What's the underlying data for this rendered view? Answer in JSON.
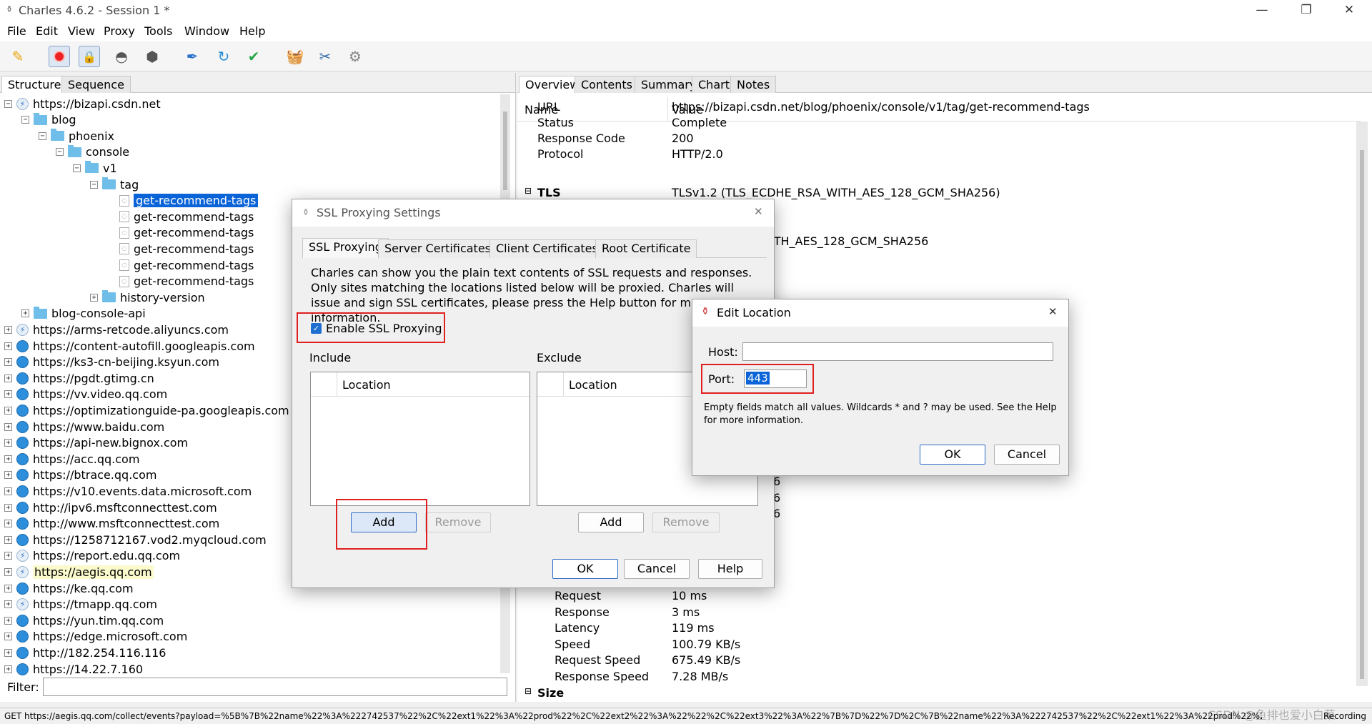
{
  "window": {
    "title": "Charles 4.6.2 - Session 1 *",
    "minimize": "—",
    "restore": "❐",
    "close": "✕"
  },
  "menu": [
    "File",
    "Edit",
    "View",
    "Proxy",
    "Tools",
    "Window",
    "Help"
  ],
  "toolbar": [
    "broom-icon",
    "record-icon",
    "throttle-lock-icon",
    "turtle-icon",
    "stop-hexagon-icon",
    "pen-icon",
    "refresh-icon",
    "check-icon",
    "basket-icon",
    "tools-icon",
    "settings-gear-icon"
  ],
  "left_tabs": [
    "Structure",
    "Sequence"
  ],
  "tree": [
    {
      "label": "https://bizapi.csdn.net",
      "icon": "bolt",
      "exp": "−",
      "depth": 0
    },
    {
      "label": "blog",
      "icon": "folder",
      "exp": "−",
      "depth": 1
    },
    {
      "label": "phoenix",
      "icon": "folder",
      "exp": "−",
      "depth": 2
    },
    {
      "label": "console",
      "icon": "folder",
      "exp": "−",
      "depth": 3
    },
    {
      "label": "v1",
      "icon": "folder",
      "exp": "−",
      "depth": 4
    },
    {
      "label": "tag",
      "icon": "folder",
      "exp": "−",
      "depth": 5
    },
    {
      "label": "get-recommend-tags",
      "icon": "doc",
      "exp": "",
      "depth": 6,
      "selected": true
    },
    {
      "label": "get-recommend-tags",
      "icon": "doc",
      "exp": "",
      "depth": 6
    },
    {
      "label": "get-recommend-tags",
      "icon": "doc",
      "exp": "",
      "depth": 6
    },
    {
      "label": "get-recommend-tags",
      "icon": "doc",
      "exp": "",
      "depth": 6
    },
    {
      "label": "get-recommend-tags",
      "icon": "doc",
      "exp": "",
      "depth": 6
    },
    {
      "label": "get-recommend-tags",
      "icon": "doc",
      "exp": "",
      "depth": 6
    },
    {
      "label": "history-version",
      "icon": "folder",
      "exp": "+",
      "depth": 5
    },
    {
      "label": "blog-console-api",
      "icon": "folder",
      "exp": "+",
      "depth": 1
    },
    {
      "label": "https://arms-retcode.aliyuncs.com",
      "icon": "bolt",
      "exp": "+",
      "depth": 0
    },
    {
      "label": "https://content-autofill.googleapis.com",
      "icon": "globe",
      "exp": "+",
      "depth": 0
    },
    {
      "label": "https://ks3-cn-beijing.ksyun.com",
      "icon": "globe",
      "exp": "+",
      "depth": 0
    },
    {
      "label": "https://pgdt.gtimg.cn",
      "icon": "globe",
      "exp": "+",
      "depth": 0
    },
    {
      "label": "https://vv.video.qq.com",
      "icon": "globe",
      "exp": "+",
      "depth": 0
    },
    {
      "label": "https://optimizationguide-pa.googleapis.com",
      "icon": "globe",
      "exp": "+",
      "depth": 0
    },
    {
      "label": "https://www.baidu.com",
      "icon": "globe",
      "exp": "+",
      "depth": 0
    },
    {
      "label": "https://api-new.bignox.com",
      "icon": "globe",
      "exp": "+",
      "depth": 0
    },
    {
      "label": "https://acc.qq.com",
      "icon": "globe",
      "exp": "+",
      "depth": 0
    },
    {
      "label": "https://btrace.qq.com",
      "icon": "globe",
      "exp": "+",
      "depth": 0
    },
    {
      "label": "https://v10.events.data.microsoft.com",
      "icon": "globe",
      "exp": "+",
      "depth": 0
    },
    {
      "label": "http://ipv6.msftconnecttest.com",
      "icon": "globe",
      "exp": "+",
      "depth": 0
    },
    {
      "label": "http://www.msftconnecttest.com",
      "icon": "globe",
      "exp": "+",
      "depth": 0
    },
    {
      "label": "https://1258712167.vod2.myqcloud.com",
      "icon": "globe",
      "exp": "+",
      "depth": 0
    },
    {
      "label": "https://report.edu.qq.com",
      "icon": "bolt",
      "exp": "+",
      "depth": 0
    },
    {
      "label": "https://aegis.qq.com",
      "icon": "bolt",
      "exp": "+",
      "depth": 0,
      "highlight": true
    },
    {
      "label": "https://ke.qq.com",
      "icon": "globe",
      "exp": "+",
      "depth": 0
    },
    {
      "label": "https://tmapp.qq.com",
      "icon": "bolt",
      "exp": "+",
      "depth": 0
    },
    {
      "label": "https://yun.tim.qq.com",
      "icon": "globe",
      "exp": "+",
      "depth": 0
    },
    {
      "label": "https://edge.microsoft.com",
      "icon": "globe",
      "exp": "+",
      "depth": 0
    },
    {
      "label": "http://182.254.116.116",
      "icon": "globe",
      "exp": "+",
      "depth": 0
    },
    {
      "label": "https://14.22.7.160",
      "icon": "globe",
      "exp": "+",
      "depth": 0
    }
  ],
  "filter": {
    "label": "Filter:",
    "value": ""
  },
  "right_tabs": [
    "Overview",
    "Contents",
    "Summary",
    "Chart",
    "Notes"
  ],
  "overview": {
    "header_name": "Name",
    "header_value": "Value",
    "rows_top": [
      {
        "name": "URL",
        "value": "https://bizapi.csdn.net/blog/phoenix/console/v1/tag/get-recommend-tags"
      },
      {
        "name": "Status",
        "value": "Complete"
      },
      {
        "name": "Response Code",
        "value": "200"
      },
      {
        "name": "Protocol",
        "value": "HTTP/2.0"
      }
    ],
    "tls_label": "TLS",
    "tls_value": "TLSv1.2 (TLS_ECDHE_RSA_WITH_AES_128_GCM_SHA256)",
    "partial_cipher": "ITH_AES_128_GCM_SHA256",
    "partial_digits": [
      "6",
      "6",
      "6"
    ],
    "rows_bottom": [
      {
        "name": "Request",
        "value": "10 ms"
      },
      {
        "name": "Response",
        "value": "3 ms"
      },
      {
        "name": "Latency",
        "value": "119 ms"
      },
      {
        "name": "Speed",
        "value": "100.79 KB/s"
      },
      {
        "name": "Request Speed",
        "value": "675.49 KB/s"
      },
      {
        "name": "Response Speed",
        "value": "7.28 MB/s"
      }
    ],
    "size_label": "Size"
  },
  "status_bar": {
    "text": "GET https://aegis.qq.com/collect/events?payload=%5B%7B%22name%22%3A%222742537%22%2C%22ext1%22%3A%22prod%22%2C%22ext2%22%3A%22%22%2C%22ext3%22%3A%22%7B%7D%22%7D%2C%7B%22name%22%3A%222742537%22%2C%22ext1%22%3A%22prod%22%2C%22ext2%22%3A...",
    "watermark": "CSDN @鱼排也爱小白菜",
    "recording": "Recording"
  },
  "ssl_dialog": {
    "title": "SSL Proxying Settings",
    "close": "✕",
    "tabs": [
      "SSL Proxying",
      "Server Certificates",
      "Client Certificates",
      "Root Certificate"
    ],
    "description": "Charles can show you the plain text contents of SSL requests and responses. Only sites matching the locations listed below will be proxied. Charles will issue and sign SSL certificates, please press the Help button for more information.",
    "enable_label": "Enable SSL Proxying",
    "include_label": "Include",
    "exclude_label": "Exclude",
    "location_header": "Location",
    "add": "Add",
    "remove": "Remove",
    "ok": "OK",
    "cancel": "Cancel",
    "help": "Help"
  },
  "edit_dialog": {
    "title": "Edit Location",
    "close": "✕",
    "host_label": "Host:",
    "host_value": "",
    "port_label": "Port:",
    "port_value": "443",
    "hint": "Empty fields match all values. Wildcards * and ? may be used. See the Help for more information.",
    "ok": "OK",
    "cancel": "Cancel"
  }
}
